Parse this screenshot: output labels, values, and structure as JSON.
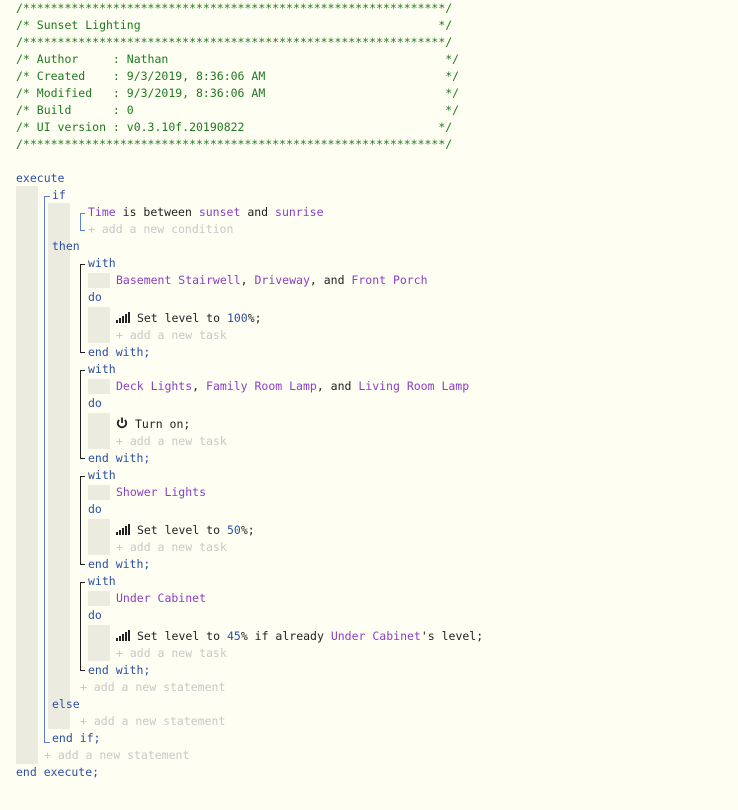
{
  "header": {
    "border_top": "/*************************************************************/",
    "title_line": "/* Sunset Lighting                                           */",
    "border_mid": "/*************************************************************/",
    "author_line": "/* Author     : Nathan                                        */",
    "created_line": "/* Created    : 9/3/2019, 8:36:06 AM                          */",
    "modified_line": "/* Modified   : 9/3/2019, 8:36:06 AM                          */",
    "build_line": "/* Build      : 0                                             */",
    "ui_line": "/* UI version : v0.3.10f.20190822                            */",
    "border_bottom": "/*************************************************************/"
  },
  "keywords": {
    "execute": "execute",
    "if": "if",
    "then": "then",
    "with": "with",
    "do": "do",
    "end_with": "end with;",
    "else": "else",
    "end_if": "end if;",
    "end_execute": "end execute;"
  },
  "condition": {
    "subject": "Time",
    "operator": "is between",
    "from": "sunset",
    "and": "and",
    "to": "sunrise"
  },
  "add_labels": {
    "condition": "+ add a new condition",
    "task": "+ add a new task",
    "statement": "+ add a new statement"
  },
  "blocks": [
    {
      "devices": [
        "Basement Stairwell",
        "Driveway",
        "Front Porch"
      ],
      "sep1": ", ",
      "sep2": ", and ",
      "task_text": "Set level to ",
      "task_value": "100",
      "task_suffix": "%;"
    },
    {
      "devices": [
        "Deck Lights",
        "Family Room Lamp",
        "Living Room Lamp"
      ],
      "sep1": ", ",
      "sep2": ", and ",
      "task_text": "Turn on;"
    },
    {
      "devices": [
        "Shower Lights"
      ],
      "task_text": "Set level to ",
      "task_value": "50",
      "task_suffix": "%;"
    },
    {
      "devices": [
        "Under Cabinet"
      ],
      "task_text": "Set level to ",
      "task_value": "45",
      "task_suffix": "% if already ",
      "task_ref": "Under Cabinet",
      "task_tail": "'s level;"
    }
  ]
}
